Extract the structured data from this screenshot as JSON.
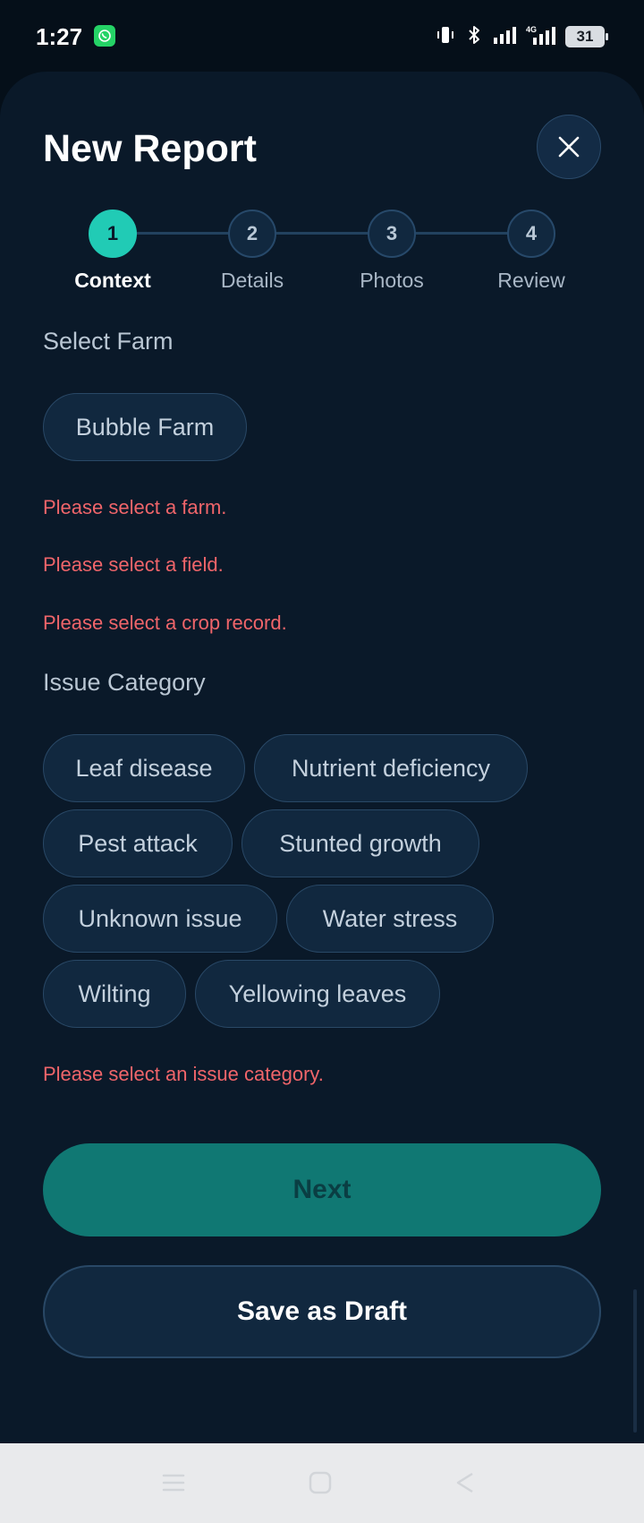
{
  "status_bar": {
    "time": "1:27",
    "battery": "31"
  },
  "header": {
    "title": "New Report"
  },
  "stepper": {
    "steps": [
      {
        "number": "1",
        "label": "Context"
      },
      {
        "number": "2",
        "label": "Details"
      },
      {
        "number": "3",
        "label": "Photos"
      },
      {
        "number": "4",
        "label": "Review"
      }
    ],
    "active_step": 1
  },
  "farm_section": {
    "label": "Select Farm",
    "options": [
      "Bubble Farm"
    ]
  },
  "errors": {
    "farm": "Please select a farm.",
    "field": "Please select a field.",
    "crop": "Please select a crop record.",
    "issue": "Please select an issue category."
  },
  "issue_section": {
    "label": "Issue Category",
    "options": [
      "Leaf disease",
      "Nutrient deficiency",
      "Pest attack",
      "Stunted growth",
      "Unknown issue",
      "Water stress",
      "Wilting",
      "Yellowing leaves"
    ]
  },
  "actions": {
    "next": "Next",
    "save_draft": "Save as Draft"
  },
  "colors": {
    "accent": "#21cbb5",
    "error": "#f0656a",
    "background": "#0a1929"
  }
}
